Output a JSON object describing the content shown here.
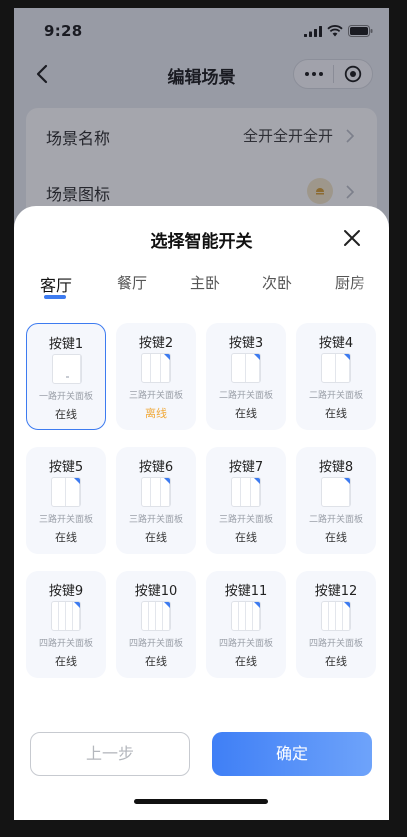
{
  "status_bar": {
    "time": "9:28"
  },
  "nav": {
    "title": "编辑场景"
  },
  "form": {
    "name_label": "场景名称",
    "name_value": "全开全开全开",
    "icon_label": "场景图标"
  },
  "sheet": {
    "title": "选择智能开关",
    "tabs": [
      {
        "label": "客厅",
        "active": true
      },
      {
        "label": "餐厅",
        "active": false
      },
      {
        "label": "主卧",
        "active": false
      },
      {
        "label": "次卧",
        "active": false
      },
      {
        "label": "厨房",
        "active": false
      }
    ],
    "switches": [
      {
        "name": "按键1",
        "type": "一路开关面板",
        "status": "在线",
        "gangs": 1,
        "selected": true,
        "offline": false
      },
      {
        "name": "按键2",
        "type": "三路开关面板",
        "status": "离线",
        "gangs": 3,
        "selected": false,
        "offline": true
      },
      {
        "name": "按键3",
        "type": "二路开关面板",
        "status": "在线",
        "gangs": 2,
        "selected": false,
        "offline": false
      },
      {
        "name": "按键4",
        "type": "二路开关面板",
        "status": "在线",
        "gangs": 2,
        "selected": false,
        "offline": false
      },
      {
        "name": "按键5",
        "type": "三路开关面板",
        "status": "在线",
        "gangs": 2,
        "selected": false,
        "offline": false
      },
      {
        "name": "按键6",
        "type": "三路开关面板",
        "status": "在线",
        "gangs": 3,
        "selected": false,
        "offline": false
      },
      {
        "name": "按键7",
        "type": "三路开关面板",
        "status": "在线",
        "gangs": 3,
        "selected": false,
        "offline": false
      },
      {
        "name": "按键8",
        "type": "二路开关面板",
        "status": "在线",
        "gangs": 1,
        "selected": false,
        "offline": false
      },
      {
        "name": "按键9",
        "type": "四路开关面板",
        "status": "在线",
        "gangs": 4,
        "selected": false,
        "offline": false
      },
      {
        "name": "按键10",
        "type": "四路开关面板",
        "status": "在线",
        "gangs": 4,
        "selected": false,
        "offline": false
      },
      {
        "name": "按键11",
        "type": "四路开关面板",
        "status": "在线",
        "gangs": 4,
        "selected": false,
        "offline": false
      },
      {
        "name": "按键12",
        "type": "四路开关面板",
        "status": "在线",
        "gangs": 4,
        "selected": false,
        "offline": false
      }
    ],
    "prev_label": "上一步",
    "confirm_label": "确定"
  },
  "colors": {
    "accent": "#3d7bf0",
    "offline": "#f0a93a",
    "card_bg": "#f5f7fc"
  },
  "icons": [
    "back-icon",
    "more-icon",
    "target-icon",
    "chevron-right-icon",
    "scene-lamp-icon",
    "close-icon",
    "signal-icon",
    "wifi-icon",
    "battery-icon"
  ]
}
